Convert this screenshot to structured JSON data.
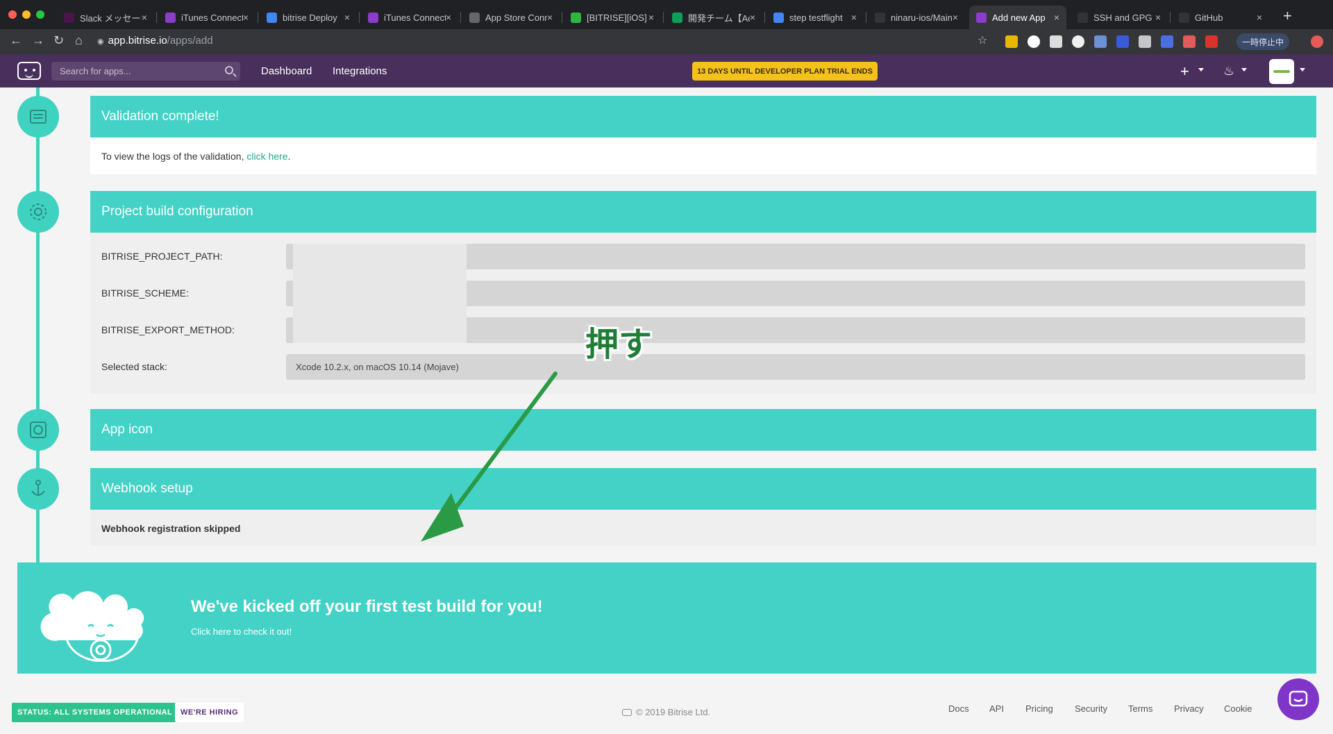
{
  "browser": {
    "tabs": [
      {
        "title": "Slack メッセージ",
        "color": "#4a154b"
      },
      {
        "title": "iTunes Connect",
        "color": "#8b3dc7"
      },
      {
        "title": "bitrise Deploy",
        "color": "#4285f4"
      },
      {
        "title": "iTunes Connect",
        "color": "#8b3dc7"
      },
      {
        "title": "App Store Connect",
        "color": "#666666"
      },
      {
        "title": "[BITRISE][iOS]",
        "color": "#2db742"
      },
      {
        "title": "開発チーム【Ad",
        "color": "#0f9d58"
      },
      {
        "title": "step testflight",
        "color": "#4285f4"
      },
      {
        "title": "ninaru-ios/Main",
        "color": "#333333"
      },
      {
        "title": "Add new App",
        "color": "#8b3dc7"
      },
      {
        "title": "SSH and GPG",
        "color": "#333333"
      },
      {
        "title": "GitHub",
        "color": "#333333"
      }
    ],
    "active_tab_index": 9,
    "url_host": "app.bitrise.io",
    "url_path": "/apps/add",
    "paused_label": "一時停止中"
  },
  "header": {
    "search_placeholder": "Search for apps...",
    "nav": [
      "Dashboard",
      "Integrations"
    ],
    "trial_banner": "13 DAYS UNTIL DEVELOPER PLAN TRIAL ENDS"
  },
  "sections": {
    "validation": {
      "title": "Validation complete!",
      "text": "To view the logs of the validation, ",
      "link": "click here",
      "suffix": "."
    },
    "config": {
      "title": "Project build configuration",
      "rows": [
        {
          "label": "BITRISE_PROJECT_PATH:",
          "value": ""
        },
        {
          "label": "BITRISE_SCHEME:",
          "value": ""
        },
        {
          "label": "BITRISE_EXPORT_METHOD:",
          "value": ""
        },
        {
          "label": "Selected stack:",
          "value": "Xcode 10.2.x, on macOS 10.14 (Mojave)"
        }
      ]
    },
    "app_icon": {
      "title": "App icon"
    },
    "webhook": {
      "title": "Webhook setup",
      "text": "Webhook registration skipped"
    }
  },
  "banner": {
    "title": "We've kicked off your first test build for you!",
    "link": "Click here to check it out!"
  },
  "annotation": {
    "text": "押す",
    "color": "#2a9a45"
  },
  "footer": {
    "status": "STATUS: ALL SYSTEMS OPERATIONAL",
    "hiring": "WE'RE HIRING",
    "copyright": "© 2019 Bitrise Ltd.",
    "links": [
      "Docs",
      "API",
      "Pricing",
      "Security",
      "Terms",
      "Privacy",
      "Cookie"
    ]
  },
  "colors": {
    "accent": "#43d2c5",
    "header": "#492f5c",
    "trial": "#f5c21b"
  }
}
